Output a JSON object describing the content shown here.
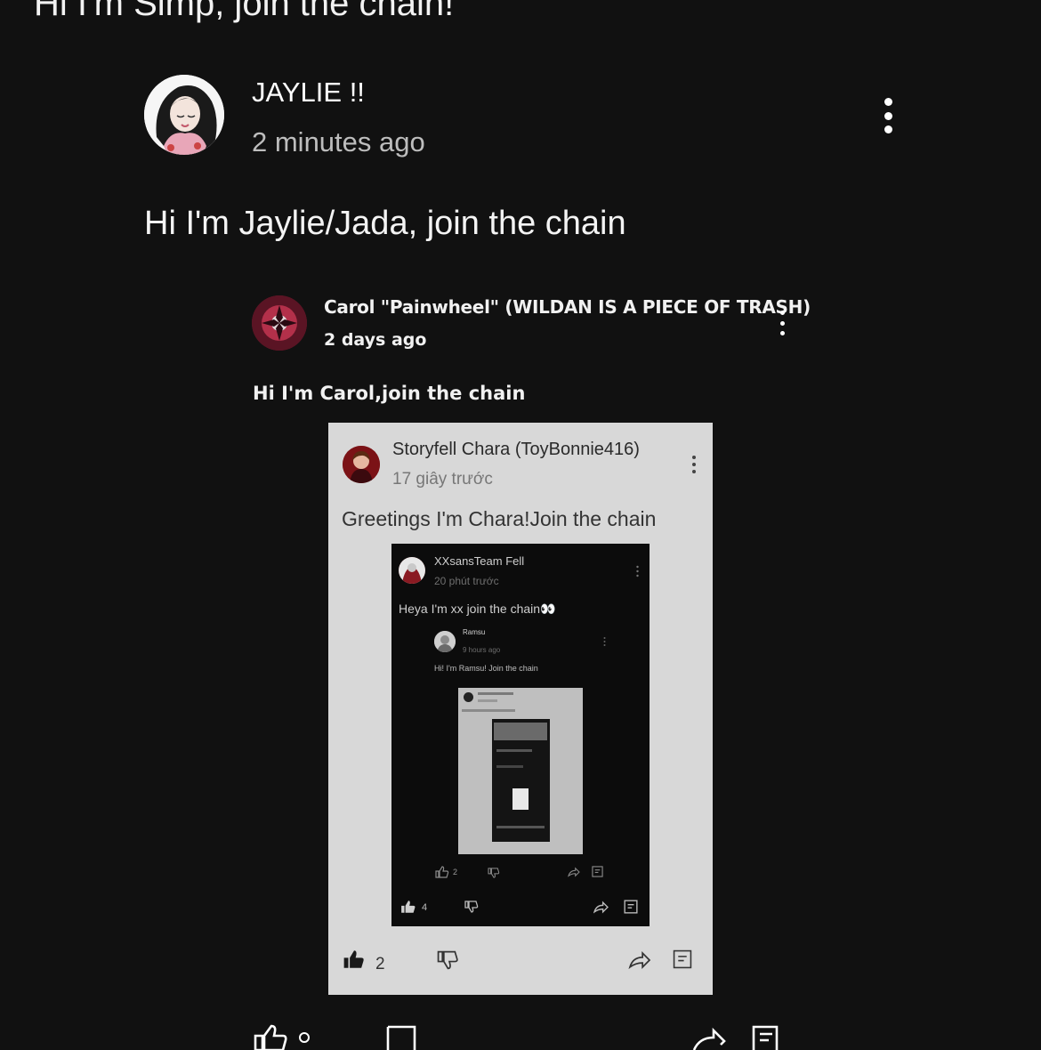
{
  "top_caption": "Hi I'm Simp, join the chain!",
  "comment": {
    "author": "JAYLIE !!",
    "time": "2 minutes ago",
    "body": "Hi I'm Jaylie/Jada, join the chain",
    "more_icon": "more-vertical-icon"
  },
  "carol": {
    "author": "Carol \"Painwheel\" (WILDAN IS A PIECE OF TRASH)",
    "time": "2 days ago",
    "body": "Hi I'm Carol,join the chain"
  },
  "chara": {
    "author": "Storyfell Chara (ToyBonnie416)",
    "time": "17 giây trước",
    "body": "Greetings I'm Chara!Join the chain",
    "likes": "2"
  },
  "xx": {
    "author": "XXsansTeam Fell",
    "time": "20 phút trước",
    "body": "Heya I'm xx join the chain👀",
    "likes": "4"
  },
  "ramsu": {
    "author": "Ramsu",
    "time": "9 hours ago",
    "body": "Hi! I'm Ramsu! Join the chain",
    "likes": "2"
  },
  "icons": {
    "like": "thumbs-up-icon",
    "dislike": "thumbs-down-icon",
    "share": "share-icon",
    "reply": "reply-icon"
  }
}
